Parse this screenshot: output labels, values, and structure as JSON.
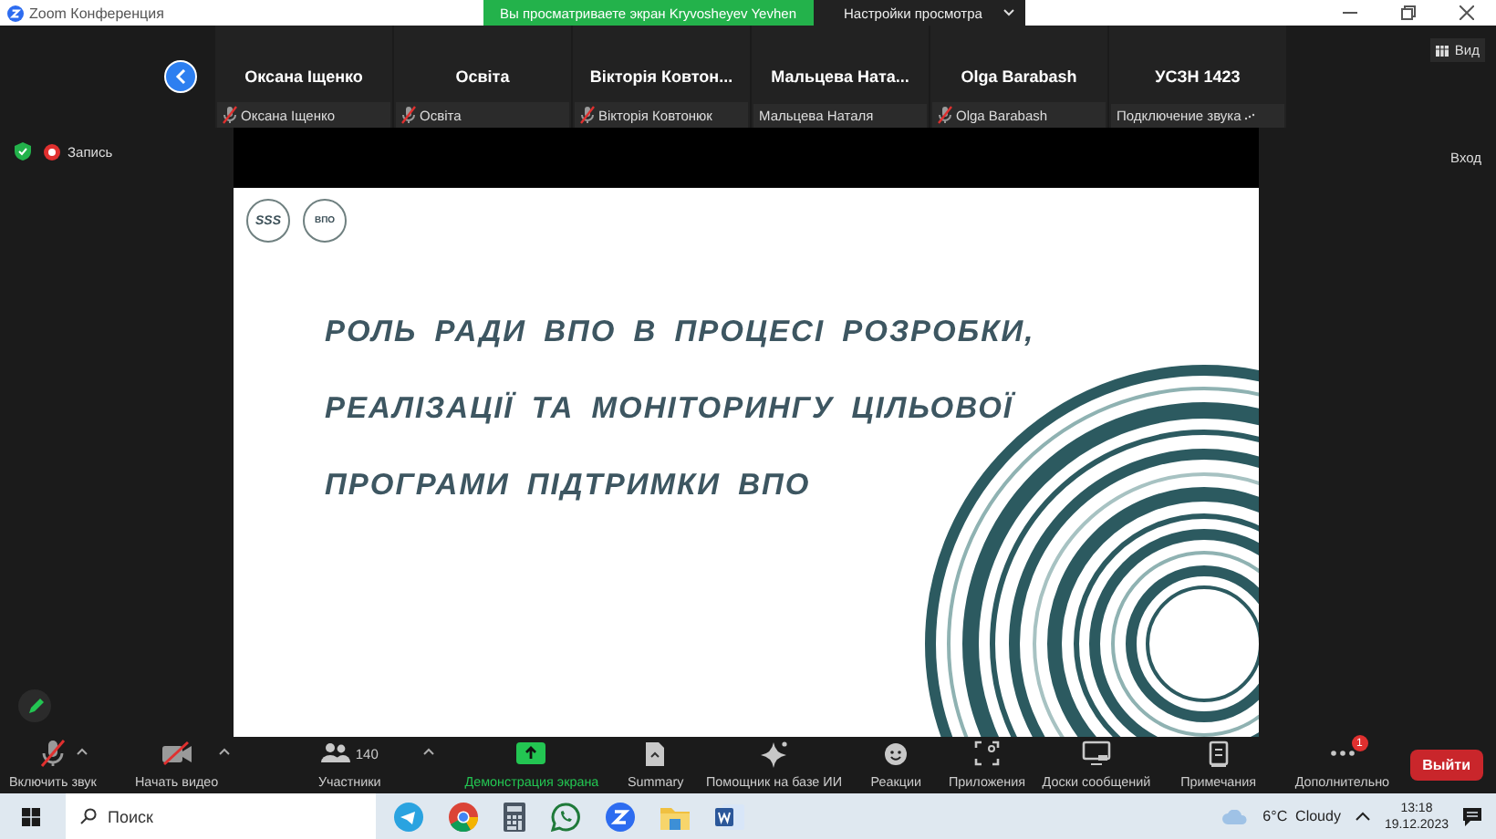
{
  "window": {
    "title": "Zoom Конференция"
  },
  "share_banner": {
    "text": "Вы просматриваете экран Kryvosheyev Yevhen",
    "settings": "Настройки просмотра"
  },
  "view_button": "Вид",
  "participants": [
    {
      "name": "Оксана Іщенко",
      "label": "Оксана Іщенко",
      "muted": true,
      "connecting": false
    },
    {
      "name": "Освіта",
      "label": "Освіта",
      "muted": true,
      "connecting": false
    },
    {
      "name": "Вікторія Ковтон...",
      "label": "Вікторія Ковтонюк",
      "muted": true,
      "connecting": false
    },
    {
      "name": "Мальцева  Ната...",
      "label": "Мальцева Наталя",
      "muted": false,
      "connecting": false
    },
    {
      "name": "Olga Barabash",
      "label": "Olga Barabash",
      "muted": true,
      "connecting": false
    },
    {
      "name": "УСЗН 1423",
      "label": "Подключение звука",
      "muted": false,
      "connecting": true
    }
  ],
  "recording": {
    "label": "Запись"
  },
  "enter_button": "Вход",
  "slide": {
    "logos": [
      "SSS",
      "ВПО"
    ],
    "lines": [
      "РОЛЬ РАДИ ВПО В ПРОЦЕСІ РОЗРОБКИ,",
      "РЕАЛІЗАЦІЇ ТА МОНІТОРИНГУ ЦІЛЬОВОЇ",
      "ПРОГРАМИ ПІДТРИМКИ ВПО"
    ]
  },
  "toolbar": [
    {
      "kind": "audio",
      "label": "Включить звук",
      "caret": true,
      "off": true
    },
    {
      "kind": "video",
      "label": "Начать видео",
      "caret": true,
      "off": true
    },
    {
      "kind": "participants",
      "label": "Участники",
      "count": "140",
      "caret": true
    },
    {
      "kind": "share",
      "label": "Демонстрация экрана",
      "active": true
    },
    {
      "kind": "summary",
      "label": "Summary"
    },
    {
      "kind": "ai",
      "label": "Помощник на базе ИИ"
    },
    {
      "kind": "reactions",
      "label": "Реакции"
    },
    {
      "kind": "apps",
      "label": "Приложения"
    },
    {
      "kind": "boards",
      "label": "Доски сообщений"
    },
    {
      "kind": "notes",
      "label": "Примечания"
    },
    {
      "kind": "more",
      "label": "Дополнительно",
      "badge": "1"
    }
  ],
  "leave_button": "Выйти",
  "taskbar": {
    "search_placeholder": "Поиск",
    "apps": [
      {
        "kind": "telegram"
      },
      {
        "kind": "chrome"
      },
      {
        "kind": "calculator"
      },
      {
        "kind": "whatsapp"
      },
      {
        "kind": "zoom"
      },
      {
        "kind": "files"
      },
      {
        "kind": "word"
      }
    ],
    "weather": "6°C  Cloudy",
    "time": "13:18",
    "date": "19.12.2023"
  }
}
